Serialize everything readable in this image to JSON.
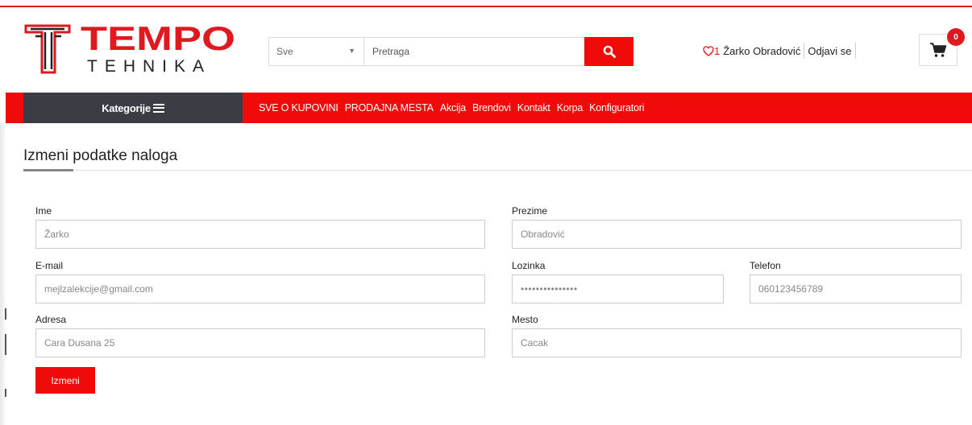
{
  "brand": {
    "name_top": "TEMPO",
    "name_bottom": "TEHNIKA",
    "red": "#e0191f",
    "dark": "#222222"
  },
  "search": {
    "category_selected": "Sve",
    "placeholder": "Pretraga",
    "button_icon": "search-icon"
  },
  "user": {
    "wishlist_icon": "heart-icon",
    "wishlist_count": "1",
    "name": "Žarko Obradović",
    "logout_label": "Odjavi se"
  },
  "cart": {
    "icon": "cart-icon",
    "count": "0"
  },
  "nav": {
    "categories_label": "Kategorije",
    "categories_icon": "menu-icon",
    "links": [
      "SVE O KUPOVINI",
      "PRODAJNA MESTA",
      "Akcija",
      "Brendovi",
      "Kontakt",
      "Korpa",
      "Konfiguratori"
    ],
    "bar_color": "#f10a0a",
    "categories_bg": "#3a3d44"
  },
  "form": {
    "title": "Izmeni podatke naloga",
    "fields": {
      "first_name": {
        "label": "Ime",
        "value": "Žarko"
      },
      "last_name": {
        "label": "Prezime",
        "value": "Obradović"
      },
      "email": {
        "label": "E-mail",
        "value": "mejlzalekcije@gmail.com"
      },
      "password": {
        "label": "Lozinka",
        "value": "•••••••••••••••"
      },
      "phone": {
        "label": "Telefon",
        "value": "060123456789"
      },
      "address": {
        "label": "Adresa",
        "value": "Cara Dusana 25"
      },
      "city": {
        "label": "Mesto",
        "value": "Cacak"
      }
    },
    "submit_label": "Izmeni"
  }
}
